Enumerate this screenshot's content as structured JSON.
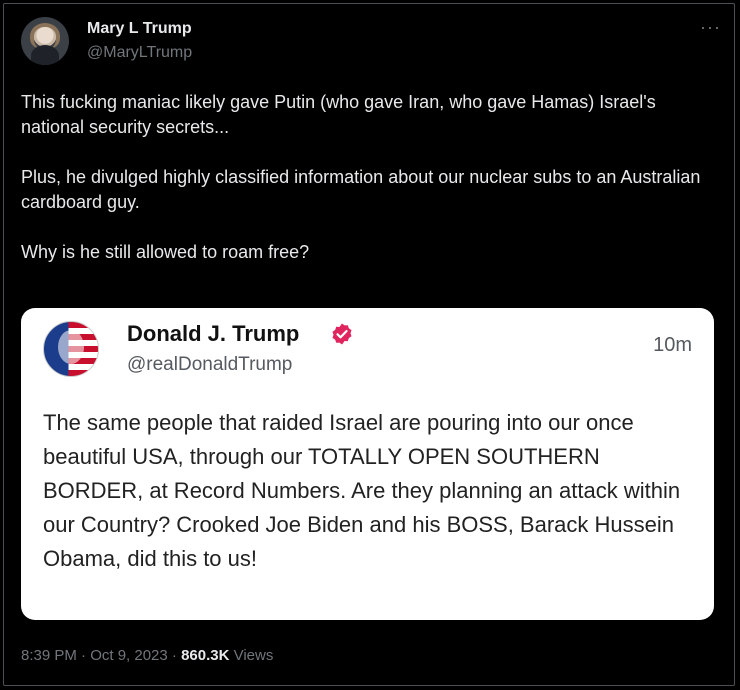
{
  "author": {
    "name": "Mary L Trump",
    "handle": "@MaryLTrump"
  },
  "more_label": "···",
  "tweet": {
    "text": "This fucking maniac likely gave Putin (who gave Iran, who gave Hamas) Israel's national security secrets...\n\nPlus, he divulged highly classified information about our nuclear subs to an Australian cardboard guy.\n\nWhy is he still allowed to roam free?"
  },
  "quoted": {
    "name": "Donald J. Trump",
    "handle": "@realDonaldTrump",
    "time": "10m",
    "text": "The same people that raided Israel are pouring into our once beautiful USA, through our TOTALLY OPEN SOUTHERN BORDER, at Record Numbers. Are they planning an attack within our Country? Crooked Joe Biden and his BOSS, Barack Hussein Obama, did this to us!",
    "verified_color": "#e0245e"
  },
  "footer": {
    "timestamp": "8:39 PM · Oct 9, 2023 · ",
    "views_count": "860.3K",
    "views_label": " Views"
  }
}
